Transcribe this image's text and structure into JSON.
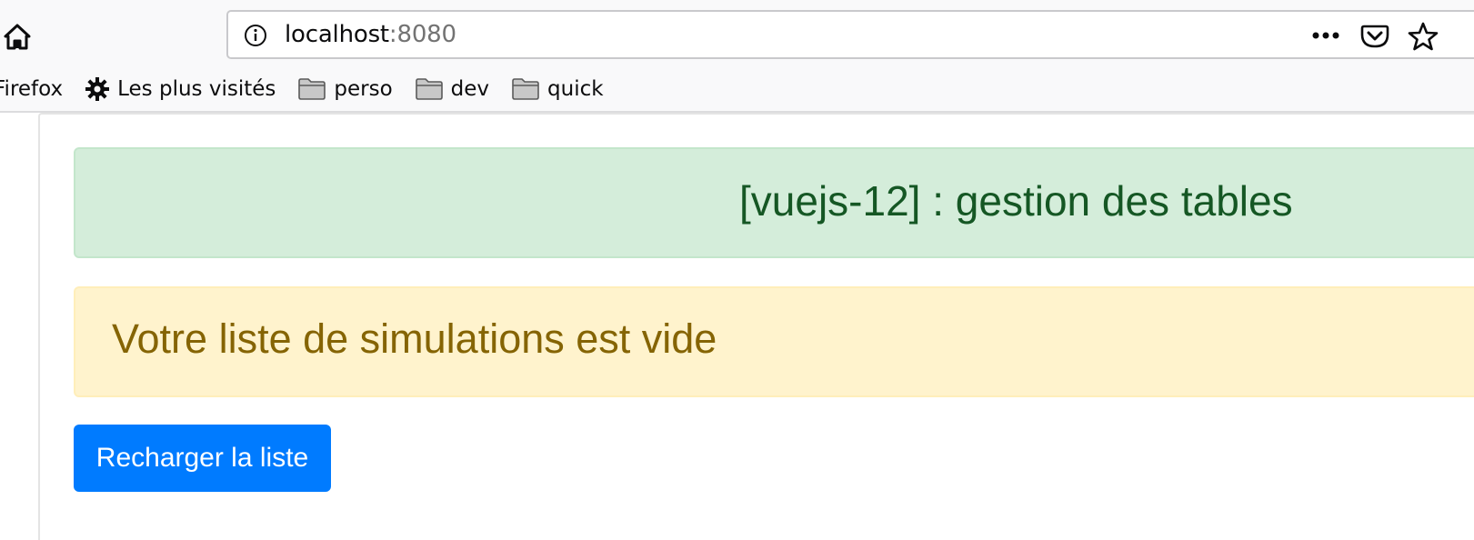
{
  "browser": {
    "url_host": "localhost",
    "url_port": ":8080",
    "bookmarks": [
      {
        "label": "Firefox",
        "icon": "none"
      },
      {
        "label": "Les plus visités",
        "icon": "gear-icon"
      },
      {
        "label": "perso",
        "icon": "folder-icon"
      },
      {
        "label": "dev",
        "icon": "folder-icon"
      },
      {
        "label": "quick",
        "icon": "folder-icon"
      }
    ]
  },
  "page": {
    "header_title": "[vuejs-12] : gestion des tables",
    "empty_message": "Votre liste de simulations est vide",
    "reload_button_label": "Recharger la liste"
  },
  "colors": {
    "success_bg": "#d4edda",
    "success_text": "#155724",
    "warning_bg": "#fff3cd",
    "warning_text": "#856404",
    "primary": "#007bff"
  }
}
